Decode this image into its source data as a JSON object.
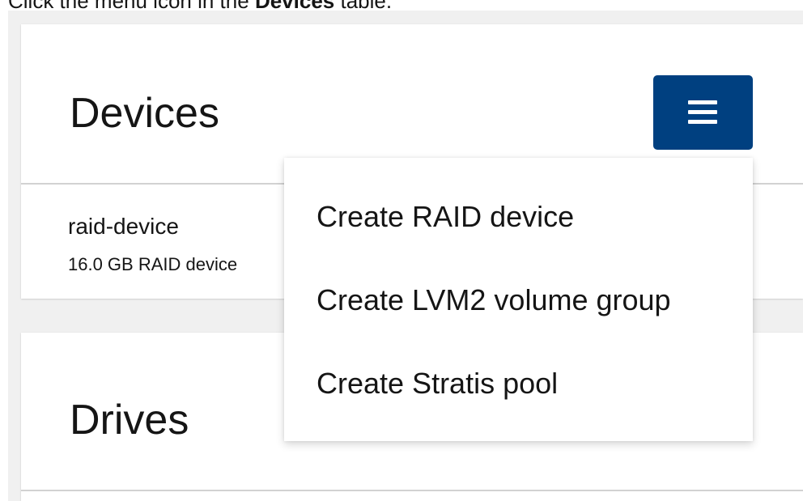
{
  "instruction": {
    "prefix": "Click the menu icon in the ",
    "bold": "Devices",
    "suffix": " table."
  },
  "devices_card": {
    "title": "Devices",
    "menu_icon": "hamburger-menu-icon",
    "rows": [
      {
        "name": "raid-device",
        "description": "16.0 GB RAID device"
      }
    ]
  },
  "dropdown": {
    "items": [
      {
        "label": "Create RAID device"
      },
      {
        "label": "Create LVM2 volume group"
      },
      {
        "label": "Create Stratis pool"
      }
    ]
  },
  "drives_card": {
    "title": "Drives"
  },
  "colors": {
    "menu_button_bg": "#004080",
    "page_bg": "#f0f0f0",
    "card_bg": "#ffffff",
    "divider": "#d2d2d2",
    "text": "#151515"
  }
}
